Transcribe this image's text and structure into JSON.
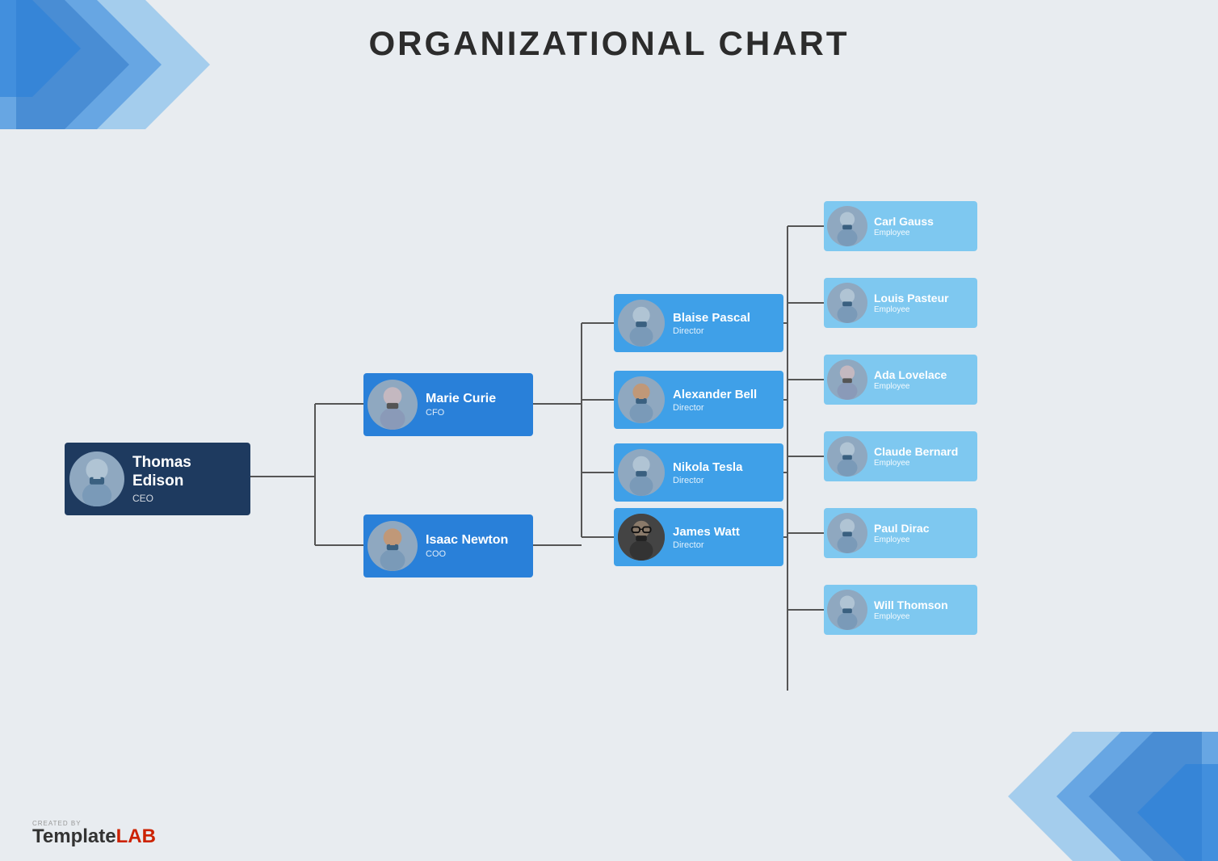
{
  "title": "ORGANIZATIONAL CHART",
  "nodes": {
    "ceo": {
      "name": "Thomas Edison",
      "role": "CEO"
    },
    "managers": [
      {
        "name": "Marie Curie",
        "role": "CFO",
        "avatar_type": "female"
      },
      {
        "name": "Isaac Newton",
        "role": "COO",
        "avatar_type": "male2"
      }
    ],
    "directors": [
      {
        "name": "Blaise Pascal",
        "role": "Director",
        "avatar_type": "male"
      },
      {
        "name": "Alexander Bell",
        "role": "Director",
        "avatar_type": "male2"
      },
      {
        "name": "Nikola Tesla",
        "role": "Director",
        "avatar_type": "male"
      },
      {
        "name": "James Watt",
        "role": "Director",
        "avatar_type": "glasses"
      }
    ],
    "employees": [
      {
        "name": "Carl Gauss",
        "role": "Employee"
      },
      {
        "name": "Louis Pasteur",
        "role": "Employee"
      },
      {
        "name": "Ada Lovelace",
        "role": "Employee",
        "avatar_type": "female"
      },
      {
        "name": "Claude Bernard",
        "role": "Employee"
      },
      {
        "name": "Paul Dirac",
        "role": "Employee"
      },
      {
        "name": "Will Thomson",
        "role": "Employee"
      }
    ]
  },
  "footer": {
    "created_by": "CREATED BY",
    "template": "Template",
    "lab": "LAB"
  }
}
